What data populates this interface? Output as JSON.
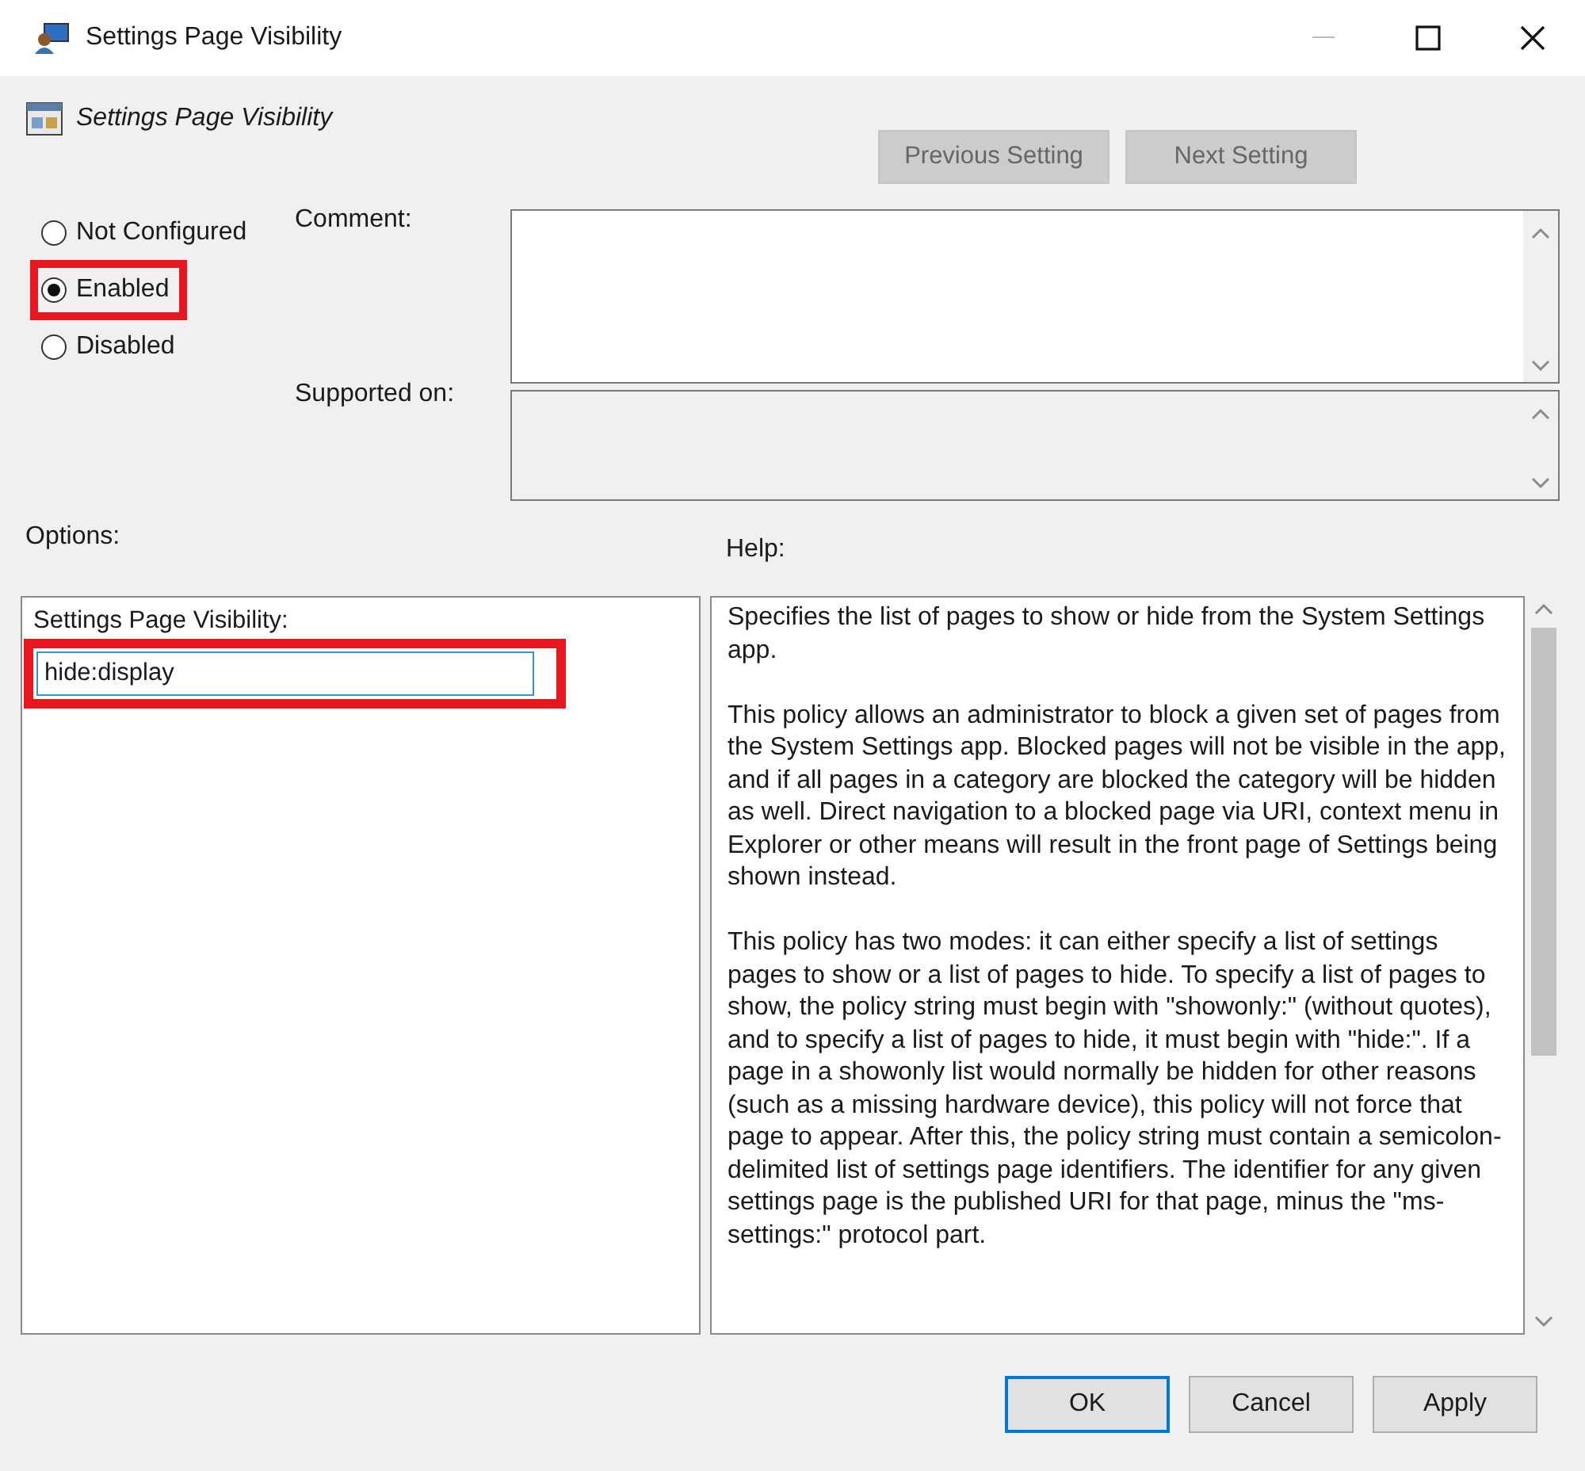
{
  "window": {
    "title": "Settings Page Visibility"
  },
  "policy_title": "Settings Page Visibility",
  "nav_buttons": [
    {
      "label": "Previous Setting",
      "disabled": true
    },
    {
      "label": "Next Setting",
      "disabled": true
    }
  ],
  "state_options": [
    {
      "label": "Not Configured",
      "selected": false,
      "highlighted": false
    },
    {
      "label": "Enabled",
      "selected": true,
      "highlighted": true
    },
    {
      "label": "Disabled",
      "selected": false,
      "highlighted": false
    }
  ],
  "comment": {
    "label": "Comment:"
  },
  "supported_on": {
    "label": "Supported on:"
  },
  "options": {
    "label": "Options:",
    "field_label": "Settings Page Visibility:",
    "value": "hide:display",
    "highlighted": true
  },
  "help": {
    "label": "Help:",
    "paragraphs": [
      "Specifies the list of pages to show or hide from the System Settings app.",
      "This policy allows an administrator to block a given set of pages from the System Settings app. Blocked pages will not be visible in the app, and if all pages in a category are blocked the category will be hidden as well. Direct navigation to a blocked page via URI, context menu in Explorer or other means will result in the front page of Settings being shown instead.",
      "This policy has two modes: it can either specify a list of settings pages to show or a list of pages to hide. To specify a list of pages to show, the policy string must begin with \"showonly:\" (without quotes), and to specify a list of pages to hide, it must begin with \"hide:\". If a page in a showonly list would normally be hidden for other reasons (such as a missing hardware device), this policy will not force that page to appear. After this, the policy string must contain a semicolon-delimited list of settings page identifiers. The identifier for any given settings page is the published URI for that page, minus the \"ms-settings:\" protocol part."
    ]
  },
  "buttons": [
    {
      "label": "OK",
      "default": true
    },
    {
      "label": "Cancel",
      "default": false
    },
    {
      "label": "Apply",
      "default": false
    }
  ]
}
